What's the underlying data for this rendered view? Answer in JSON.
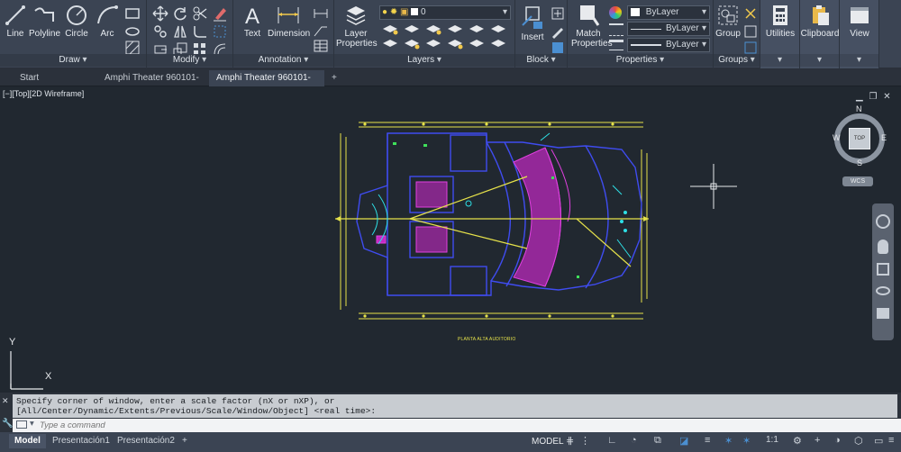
{
  "ribbon": {
    "draw": {
      "title": "Draw",
      "line": "Line",
      "polyline": "Polyline",
      "circle": "Circle",
      "arc": "Arc"
    },
    "modify": {
      "title": "Modify"
    },
    "annotation": {
      "title": "Annotation",
      "text": "Text",
      "dimension": "Dimension"
    },
    "layers": {
      "title": "Layers",
      "layer_properties": "Layer Properties",
      "current_layer": "0"
    },
    "block": {
      "title": "Block",
      "insert": "Insert"
    },
    "properties": {
      "title": "Properties",
      "match_properties": "Match Properties",
      "color": "ByLayer",
      "linetype": "ByLayer",
      "lineweight": "ByLayer"
    },
    "groups": {
      "title": "Groups",
      "group": "Group"
    },
    "utilities": {
      "title": "Utilities"
    },
    "clipboard": {
      "title": "Clipboard"
    },
    "view": {
      "title": "View"
    }
  },
  "tabs": [
    {
      "label": "Start"
    },
    {
      "label": "Amphi Theater 960101-1*"
    },
    {
      "label": "Amphi Theater 960101-2*"
    }
  ],
  "viewport": {
    "label": "[−][Top][2D Wireframe]",
    "viewcube": {
      "n": "N",
      "s": "S",
      "e": "E",
      "w": "W",
      "face": "TOP",
      "wcs": "WCS"
    },
    "ucs": {
      "x": "X",
      "y": "Y"
    },
    "drawing_caption": "PLANTA ALTA AUDITORIO"
  },
  "command": {
    "history_1": "Specify corner of window, enter a scale factor (nX or nXP), or",
    "history_2": "[All/Center/Dynamic/Extents/Previous/Scale/Window/Object] <real time>:",
    "placeholder": "Type a command"
  },
  "status": {
    "layout_tabs": [
      "Model",
      "Presentación1",
      "Presentación2"
    ],
    "model_label": "MODEL",
    "scale": "1:1"
  },
  "colors": {
    "accent": "#4b8fd1",
    "ribbon_bg": "#3b4453",
    "canvas_bg": "#212830"
  }
}
